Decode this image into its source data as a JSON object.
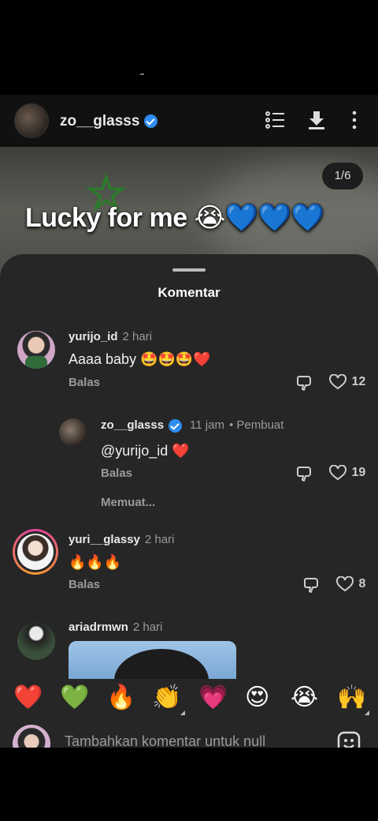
{
  "header": {
    "username": "zo__glasss",
    "pager": "1/6"
  },
  "post": {
    "caption": "Lucky for me 😭💙💙💙"
  },
  "sheet": {
    "title": "Komentar"
  },
  "comments": [
    {
      "username": "yurijo_id",
      "time": "2 hari",
      "text": "Aaaa baby 🤩🤩🤩❤️",
      "reply": "Balas",
      "likes": "12"
    },
    {
      "username": "zo__glasss",
      "time": "11 jam",
      "creator": "• Pembuat",
      "text": "@yurijo_id ❤️",
      "reply": "Balas",
      "likes": "19"
    },
    {
      "loading": "Memuat..."
    },
    {
      "username": "yuri__glassy",
      "time": "2 hari",
      "text": "🔥🔥🔥",
      "reply": "Balas",
      "likes": "8"
    },
    {
      "username": "ariadrmwn",
      "time": "2 hari"
    }
  ],
  "emoji_bar": [
    "❤️",
    "💚",
    "🔥",
    "👏",
    "💗",
    "😍",
    "😭",
    "🙌"
  ],
  "input": {
    "placeholder": "Tambahkan komentar untuk null"
  },
  "colors": {
    "verified": "#2d8cf0",
    "sheet": "#262626",
    "story_ring": "#e040a0"
  }
}
